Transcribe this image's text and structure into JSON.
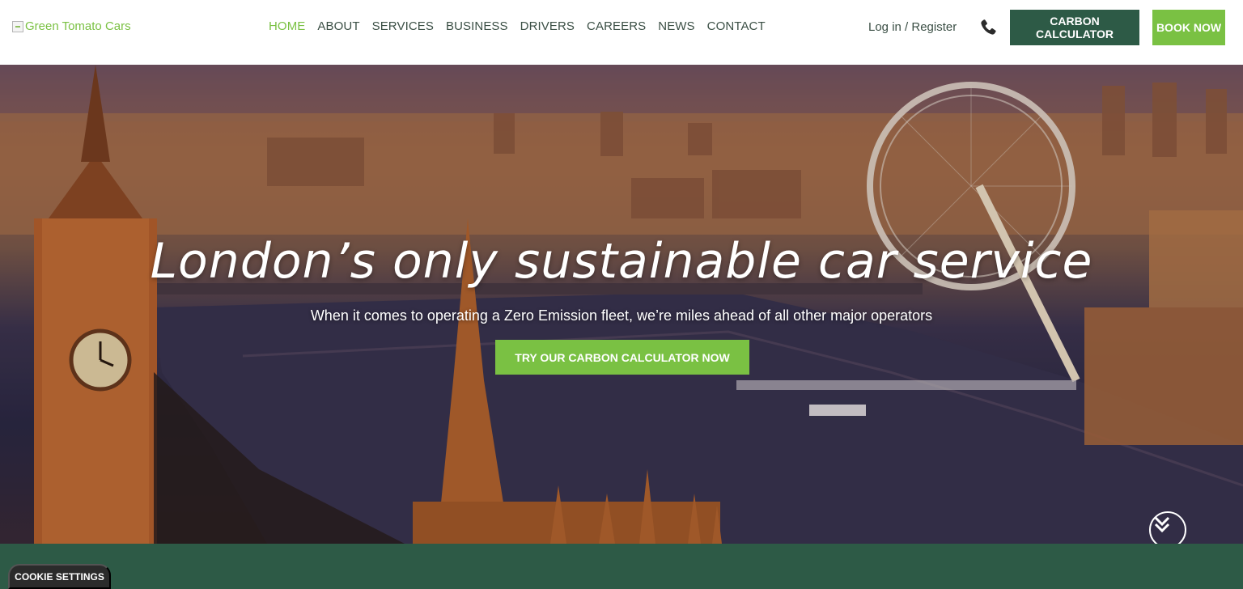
{
  "header": {
    "logo_alt": "Green Tomato Cars",
    "nav": [
      {
        "label": "HOME",
        "active": true
      },
      {
        "label": "ABOUT"
      },
      {
        "label": "SERVICES"
      },
      {
        "label": "BUSINESS"
      },
      {
        "label": "DRIVERS"
      },
      {
        "label": "CAREERS"
      },
      {
        "label": "NEWS"
      },
      {
        "label": "CONTACT"
      }
    ],
    "login_label": "Log in / Register",
    "phone_icon": "phone-icon",
    "carbon_button": "CARBON CALCULATOR",
    "book_button": "BOOK NOW"
  },
  "hero": {
    "title": "London’s only sustainable car service",
    "subtitle": "When it comes to operating a Zero Emission fleet, we’re miles ahead of all other major operators",
    "cta_label": "TRY OUR CARBON CALCULATOR NOW",
    "scroll_icon": "chevron-double-down-icon"
  },
  "footer": {
    "cookie_label": "COOKIE SETTINGS"
  },
  "colors": {
    "brand_green": "#7ac143",
    "dark_green": "#2d5a46",
    "nav_text": "#3b4f45"
  }
}
